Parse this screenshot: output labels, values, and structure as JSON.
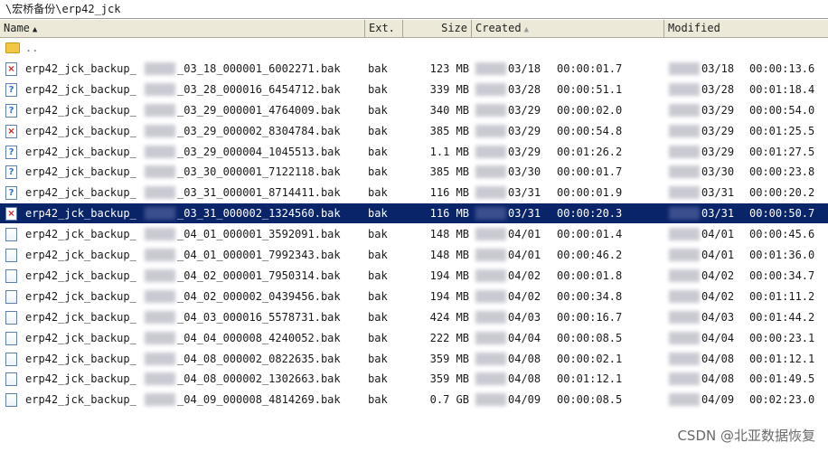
{
  "path": "\\宏桥备份\\erp42_jck",
  "columns": {
    "name": "Name",
    "ext": "Ext.",
    "size": "Size",
    "created": "Created",
    "modified": "Modified"
  },
  "parent_row": {
    "label": ".."
  },
  "rows": [
    {
      "icon": "x",
      "name_prefix": "erp42_jck_backup_",
      "name_suffix": "_03_18_000001_6002271.bak",
      "ext": "bak",
      "size": "123 MB",
      "cdate": "03/18",
      "ctime": "00:00:01.7",
      "mdate": "03/18",
      "mtime": "00:00:13.6"
    },
    {
      "icon": "q",
      "name_prefix": "erp42_jck_backup_",
      "name_suffix": "_03_28_000016_6454712.bak",
      "ext": "bak",
      "size": "339 MB",
      "cdate": "03/28",
      "ctime": "00:00:51.1",
      "mdate": "03/28",
      "mtime": "00:01:18.4"
    },
    {
      "icon": "q",
      "name_prefix": "erp42_jck_backup_",
      "name_suffix": "_03_29_000001_4764009.bak",
      "ext": "bak",
      "size": "340 MB",
      "cdate": "03/29",
      "ctime": "00:00:02.0",
      "mdate": "03/29",
      "mtime": "00:00:54.0"
    },
    {
      "icon": "x",
      "name_prefix": "erp42_jck_backup_",
      "name_suffix": "_03_29_000002_8304784.bak",
      "ext": "bak",
      "size": "385 MB",
      "cdate": "03/29",
      "ctime": "00:00:54.8",
      "mdate": "03/29",
      "mtime": "00:01:25.5"
    },
    {
      "icon": "q",
      "name_prefix": "erp42_jck_backup_",
      "name_suffix": "_03_29_000004_1045513.bak",
      "ext": "bak",
      "size": "1.1 MB",
      "cdate": "03/29",
      "ctime": "00:01:26.2",
      "mdate": "03/29",
      "mtime": "00:01:27.5"
    },
    {
      "icon": "q",
      "name_prefix": "erp42_jck_backup_",
      "name_suffix": "_03_30_000001_7122118.bak",
      "ext": "bak",
      "size": "385 MB",
      "cdate": "03/30",
      "ctime": "00:00:01.7",
      "mdate": "03/30",
      "mtime": "00:00:23.8"
    },
    {
      "icon": "q",
      "name_prefix": "erp42_jck_backup_",
      "name_suffix": "_03_31_000001_8714411.bak",
      "ext": "bak",
      "size": "116 MB",
      "cdate": "03/31",
      "ctime": "00:00:01.9",
      "mdate": "03/31",
      "mtime": "00:00:20.2"
    },
    {
      "icon": "x",
      "selected": true,
      "name_prefix": "erp42_jck_backup_",
      "name_suffix": "_03_31_000002_1324560.bak",
      "ext": "bak",
      "size": "116 MB",
      "cdate": "03/31",
      "ctime": "00:00:20.3",
      "mdate": "03/31",
      "mtime": "00:00:50.7"
    },
    {
      "icon": "doc",
      "name_prefix": "erp42_jck_backup_",
      "name_suffix": "_04_01_000001_3592091.bak",
      "ext": "bak",
      "size": "148 MB",
      "cdate": "04/01",
      "ctime": "00:00:01.4",
      "mdate": "04/01",
      "mtime": "00:00:45.6"
    },
    {
      "icon": "doc",
      "name_prefix": "erp42_jck_backup_",
      "name_suffix": "_04_01_000001_7992343.bak",
      "ext": "bak",
      "size": "148 MB",
      "cdate": "04/01",
      "ctime": "00:00:46.2",
      "mdate": "04/01",
      "mtime": "00:01:36.0"
    },
    {
      "icon": "doc",
      "name_prefix": "erp42_jck_backup_",
      "name_suffix": "_04_02_000001_7950314.bak",
      "ext": "bak",
      "size": "194 MB",
      "cdate": "04/02",
      "ctime": "00:00:01.8",
      "mdate": "04/02",
      "mtime": "00:00:34.7"
    },
    {
      "icon": "doc",
      "name_prefix": "erp42_jck_backup_",
      "name_suffix": "_04_02_000002_0439456.bak",
      "ext": "bak",
      "size": "194 MB",
      "cdate": "04/02",
      "ctime": "00:00:34.8",
      "mdate": "04/02",
      "mtime": "00:01:11.2"
    },
    {
      "icon": "doc",
      "name_prefix": "erp42_jck_backup_",
      "name_suffix": "_04_03_000016_5578731.bak",
      "ext": "bak",
      "size": "424 MB",
      "cdate": "04/03",
      "ctime": "00:00:16.7",
      "mdate": "04/03",
      "mtime": "00:01:44.2"
    },
    {
      "icon": "doc",
      "name_prefix": "erp42_jck_backup_",
      "name_suffix": "_04_04_000008_4240052.bak",
      "ext": "bak",
      "size": "222 MB",
      "cdate": "04/04",
      "ctime": "00:00:08.5",
      "mdate": "04/04",
      "mtime": "00:00:23.1"
    },
    {
      "icon": "doc",
      "name_prefix": "erp42_jck_backup_",
      "name_suffix": "_04_08_000002_0822635.bak",
      "ext": "bak",
      "size": "359 MB",
      "cdate": "04/08",
      "ctime": "00:00:02.1",
      "mdate": "04/08",
      "mtime": "00:01:12.1"
    },
    {
      "icon": "doc",
      "name_prefix": "erp42_jck_backup_",
      "name_suffix": "_04_08_000002_1302663.bak",
      "ext": "bak",
      "size": "359 MB",
      "cdate": "04/08",
      "ctime": "00:01:12.1",
      "mdate": "04/08",
      "mtime": "00:01:49.5"
    },
    {
      "icon": "doc",
      "name_prefix": "erp42_jck_backup_",
      "name_suffix": "_04_09_000008_4814269.bak",
      "ext": "bak",
      "size": "0.7 GB",
      "cdate": "04/09",
      "ctime": "00:00:08.5",
      "mdate": "04/09",
      "mtime": "00:02:23.0"
    }
  ],
  "watermark": "CSDN @北亚数据恢复"
}
